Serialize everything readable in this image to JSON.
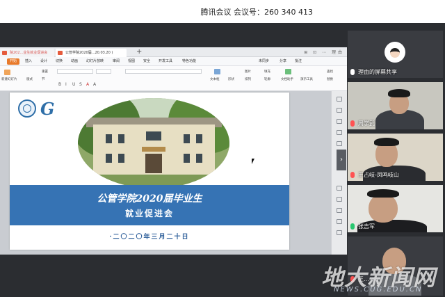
{
  "meeting": {
    "info": "腾讯会议 会议号：260 340 413"
  },
  "share_window": {
    "tabs": [
      {
        "label": "院202...业生就业促进会",
        "active": false
      },
      {
        "label": "公管学院2020届...20.03.20 )",
        "active": true
      }
    ],
    "tab_plus": "+",
    "window_controls": "⊞ ⊡ ⋯",
    "user_label": "理由",
    "menu": [
      "开始",
      "插入",
      "设计",
      "切换",
      "动画",
      "幻灯片放映",
      "审阅",
      "视图",
      "安全",
      "开发工具",
      "特色功能"
    ],
    "ribbon": {
      "new_slide": "新建幻灯片",
      "layout": "版式",
      "textbox": "文本框",
      "shape": "形状",
      "arrange": "排列",
      "outline": "轮廓",
      "picture": "图片",
      "fill": "填充",
      "find": "查找",
      "replace": "替换",
      "text_tool": "文档助手",
      "present_tool": "演示工具",
      "sync": "未同步",
      "share": "分享",
      "comment": "批注",
      "reset": "重置",
      "section": "节",
      "format_glyphs": [
        "B",
        "I",
        "U",
        "S",
        "A",
        "A"
      ]
    }
  },
  "slide": {
    "logo_letter": "G",
    "title_line1": "公管学院2020届毕业生",
    "title_line2": "就业促进会",
    "date": "·二〇二〇年三月二十日"
  },
  "participants": [
    {
      "name": "理由的屏幕共享",
      "type": "screen-share",
      "mic": "white"
    },
    {
      "name": "周学武",
      "type": "video",
      "mic": "off"
    },
    {
      "name": "王占岐-凤鸣岐山",
      "type": "video",
      "mic": "off"
    },
    {
      "name": "张吉军",
      "type": "video",
      "mic": "on"
    },
    {
      "name": "王...",
      "type": "video",
      "mic": "off"
    }
  ],
  "watermark": {
    "title": "地大新闻网",
    "url": "NEWS.CUG.EDU.CN"
  },
  "scroll_arrow": "›",
  "colors": {
    "meeting_bg": "#2b2d31",
    "slide_banner": "#3673b4",
    "wps_accent": "#e87a2b",
    "mic_on": "#28c76f",
    "mic_off": "#ff5252"
  }
}
